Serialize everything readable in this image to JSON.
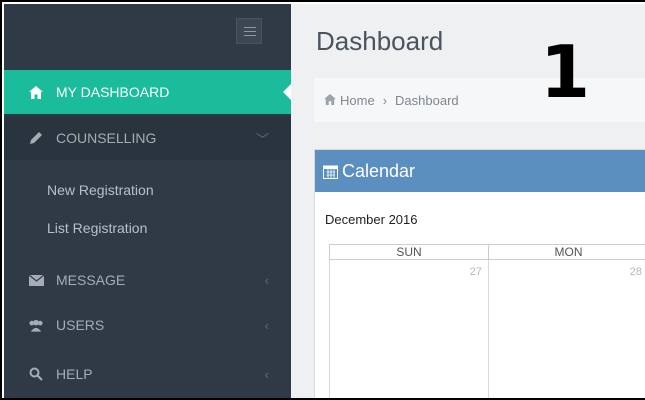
{
  "sidebar": {
    "items": [
      {
        "label": "MY DASHBOARD",
        "icon": "home-icon",
        "active": true
      },
      {
        "label": "COUNSELLING",
        "icon": "pencil-icon",
        "chevron": "﹀"
      },
      {
        "label": "MESSAGE",
        "icon": "envelope-icon",
        "chevron": "‹"
      },
      {
        "label": "USERS",
        "icon": "users-icon",
        "chevron": "‹"
      },
      {
        "label": "HELP",
        "icon": "search-icon",
        "chevron": "‹"
      }
    ],
    "submenu": [
      "New Registration",
      "List Registration"
    ]
  },
  "main": {
    "title": "Dashboard",
    "breadcrumb": {
      "home": "Home",
      "separator": "›",
      "current": "Dashboard"
    },
    "calendar": {
      "title": "Calendar",
      "month": "December 2016",
      "days": [
        {
          "name": "SUN",
          "date": "27"
        },
        {
          "name": "MON",
          "date": "28"
        }
      ]
    }
  },
  "overlay": {
    "step_number": "1"
  },
  "colors": {
    "sidebar": "#2f3a46",
    "active": "#1abc9c",
    "calendar_header": "#5b8fbf"
  }
}
